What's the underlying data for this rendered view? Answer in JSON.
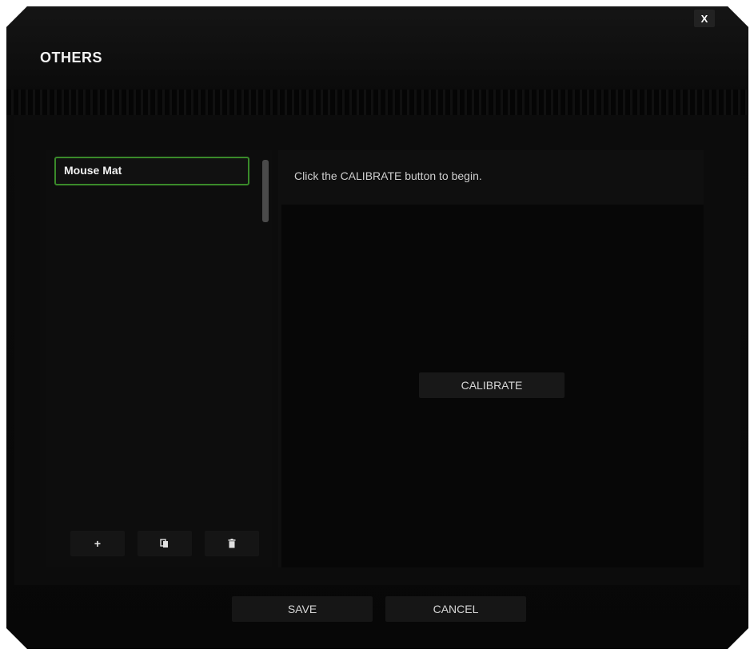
{
  "window": {
    "title": "OTHERS",
    "close_label": "X"
  },
  "profiles": {
    "items": [
      {
        "label": "Mouse Mat",
        "selected": true
      }
    ],
    "add_label": "+"
  },
  "calibration": {
    "instruction": "Click the CALIBRATE button to begin.",
    "calibrate_label": "CALIBRATE"
  },
  "footer": {
    "save_label": "SAVE",
    "cancel_label": "CANCEL"
  },
  "icons": {
    "add": "plus-icon",
    "copy": "copy-icon",
    "delete": "trash-icon",
    "close": "close-icon"
  },
  "colors": {
    "accent": "#3a8a2a",
    "background": "#0a0a0a",
    "text": "#f0f0f0"
  }
}
